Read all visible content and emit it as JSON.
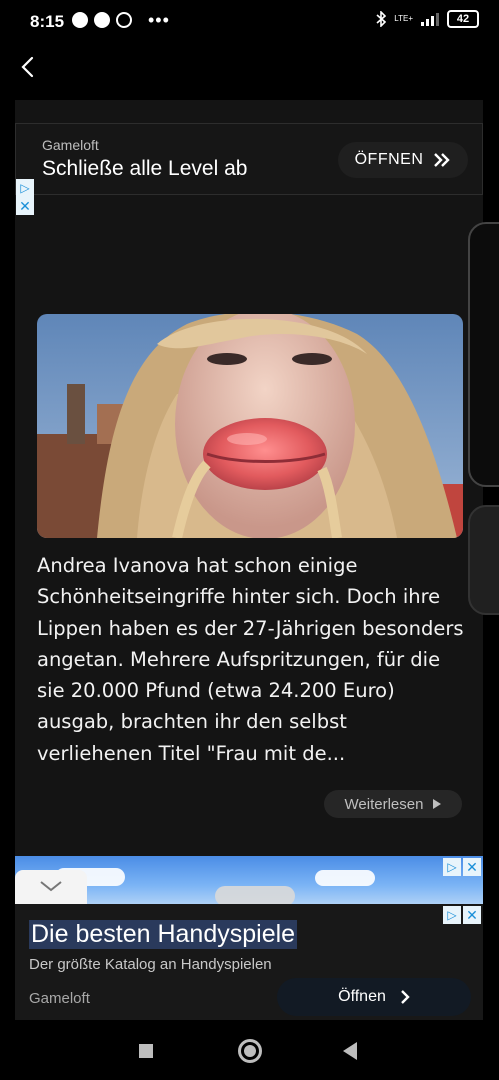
{
  "status": {
    "time": "8:15",
    "network": "LTE+",
    "battery": "42"
  },
  "top_ad": {
    "brand": "Gameloft",
    "title": "Schließe alle Level ab",
    "open_label": "ÖFFNEN"
  },
  "article": {
    "text": "Andrea Ivanova hat schon einige Schönheitseingriffe hinter sich. Doch ihre Lippen haben es der 27-Jährigen besonders angetan. Mehrere Aufspritzungen, für die sie 20.000 Pfund (etwa 24.200 Euro) ausgab, brachten ihr den selbst verliehenen Titel \"Frau mit de...",
    "more_label": "Weiterlesen"
  },
  "bottom_ad": {
    "title": "Die besten Handyspiele",
    "subtitle": "Der größte Katalog an Handyspielen",
    "brand": "Gameloft",
    "open_label": "Öffnen"
  },
  "icons": {
    "back": "chevron-left-icon",
    "ad_info": "ad-choices-icon",
    "ad_close": "close-icon",
    "nav_recents": "square-icon",
    "nav_home": "circle-icon",
    "nav_back": "triangle-back-icon"
  },
  "colors": {
    "background": "#000000",
    "card": "#141414",
    "ad_blue": "#1a8fd8"
  }
}
